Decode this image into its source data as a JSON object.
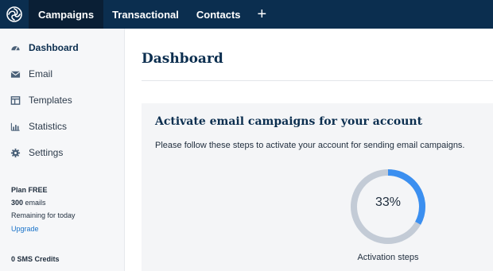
{
  "topnav": {
    "logo_icon": "sendinblue-spiral-logo",
    "items": [
      {
        "label": "Campaigns",
        "active": true
      },
      {
        "label": "Transactional",
        "active": false
      },
      {
        "label": "Contacts",
        "active": false
      }
    ],
    "add_label": "+"
  },
  "sidebar": {
    "items": [
      {
        "label": "Dashboard",
        "icon": "gauge-icon",
        "active": true
      },
      {
        "label": "Email",
        "icon": "envelope-icon",
        "active": false
      },
      {
        "label": "Templates",
        "icon": "template-icon",
        "active": false
      },
      {
        "label": "Statistics",
        "icon": "bar-chart-icon",
        "active": false
      },
      {
        "label": "Settings",
        "icon": "gear-icon",
        "active": false
      }
    ],
    "plan": {
      "title": "Plan FREE",
      "emails_count": "300",
      "emails_unit": "emails",
      "remaining": "Remaining for today",
      "upgrade": "Upgrade"
    },
    "sms": {
      "title": "0 SMS Credits"
    }
  },
  "main": {
    "title": "Dashboard",
    "card": {
      "title": "Activate email campaigns for your account",
      "description": "Please follow these steps to activate your account for sending email campaigns.",
      "progress_percent": 33,
      "progress_text": "33%",
      "progress_label": "Activation steps"
    }
  },
  "colors": {
    "topbar": "#0b2e4f",
    "topbar_active": "#0a1f35",
    "progress_fill": "#3b8ff0",
    "progress_track": "#c3cbd6",
    "link": "#1a73c9"
  }
}
